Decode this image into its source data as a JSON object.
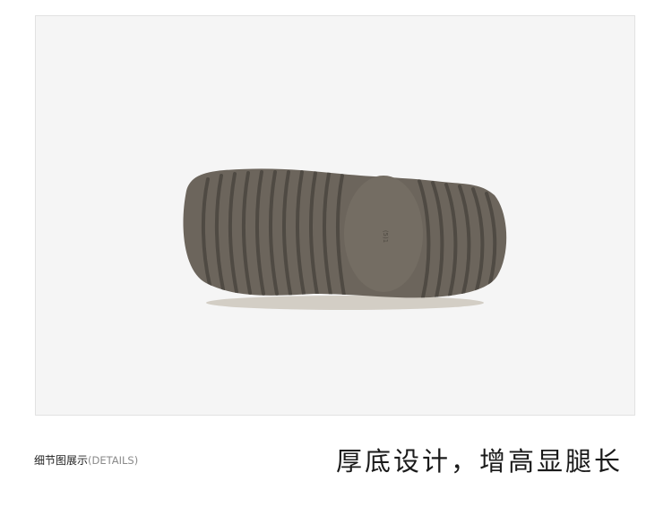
{
  "detail_label": {
    "zh": "细节图展示",
    "en": "(DETAILS)"
  },
  "headline": "厚底设计，增高显腿长",
  "sole_imprint": "(5)1",
  "colors": {
    "background": "#f5f5f5",
    "sole": "#6c655c",
    "sole_groove": "#4f4a43",
    "midsole_edge": "#cfcac0"
  }
}
